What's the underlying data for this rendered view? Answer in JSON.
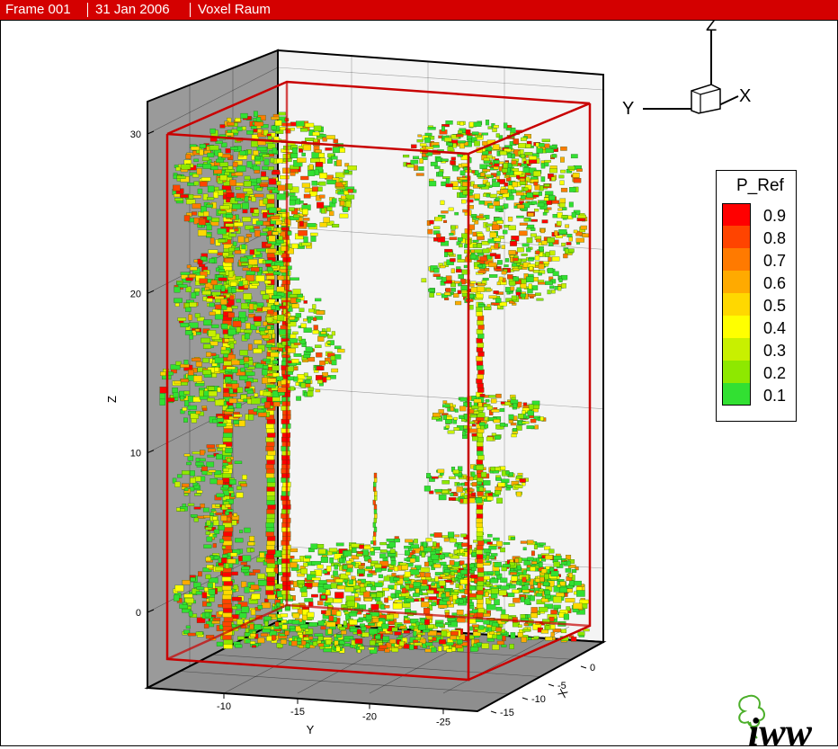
{
  "header": {
    "frame": "Frame 001",
    "date": "31 Jan 2006",
    "title": "Voxel Raum"
  },
  "axis_triad": {
    "x": "X",
    "y": "Y",
    "z": "Z"
  },
  "legend": {
    "title": "P_Ref",
    "levels": [
      "0.9",
      "0.8",
      "0.7",
      "0.6",
      "0.5",
      "0.4",
      "0.3",
      "0.2",
      "0.1"
    ],
    "colors": [
      "#ff0000",
      "#ff4400",
      "#ff7a00",
      "#ffaa00",
      "#ffd800",
      "#ffff00",
      "#c8f000",
      "#8ee800",
      "#32e032"
    ]
  },
  "chart_data": {
    "type": "scatter",
    "subtype": "3d-voxel",
    "zlabel": "Z",
    "ylabel": "Y",
    "xlabel": "X",
    "z_ticks": [
      "30",
      "20",
      "10",
      "0"
    ],
    "y_ticks": [
      "-10",
      "-15",
      "-20",
      "-25"
    ],
    "x_ticks": [
      "0",
      "-5",
      "-10",
      "-15"
    ],
    "zlim": [
      -4,
      33
    ],
    "ylim": [
      -7,
      -27
    ],
    "xlim": [
      3,
      -17
    ],
    "color_variable": "P_Ref",
    "colormap_levels": [
      0.1,
      0.2,
      0.3,
      0.4,
      0.5,
      0.6,
      0.7,
      0.8,
      0.9
    ],
    "trees": [
      {
        "y": -10.5,
        "x": -7,
        "height": 31
      },
      {
        "y": -14,
        "x": -8,
        "height": 31
      },
      {
        "y": -21,
        "x": -4,
        "height": 30
      }
    ]
  },
  "logo": {
    "text": "iww"
  }
}
